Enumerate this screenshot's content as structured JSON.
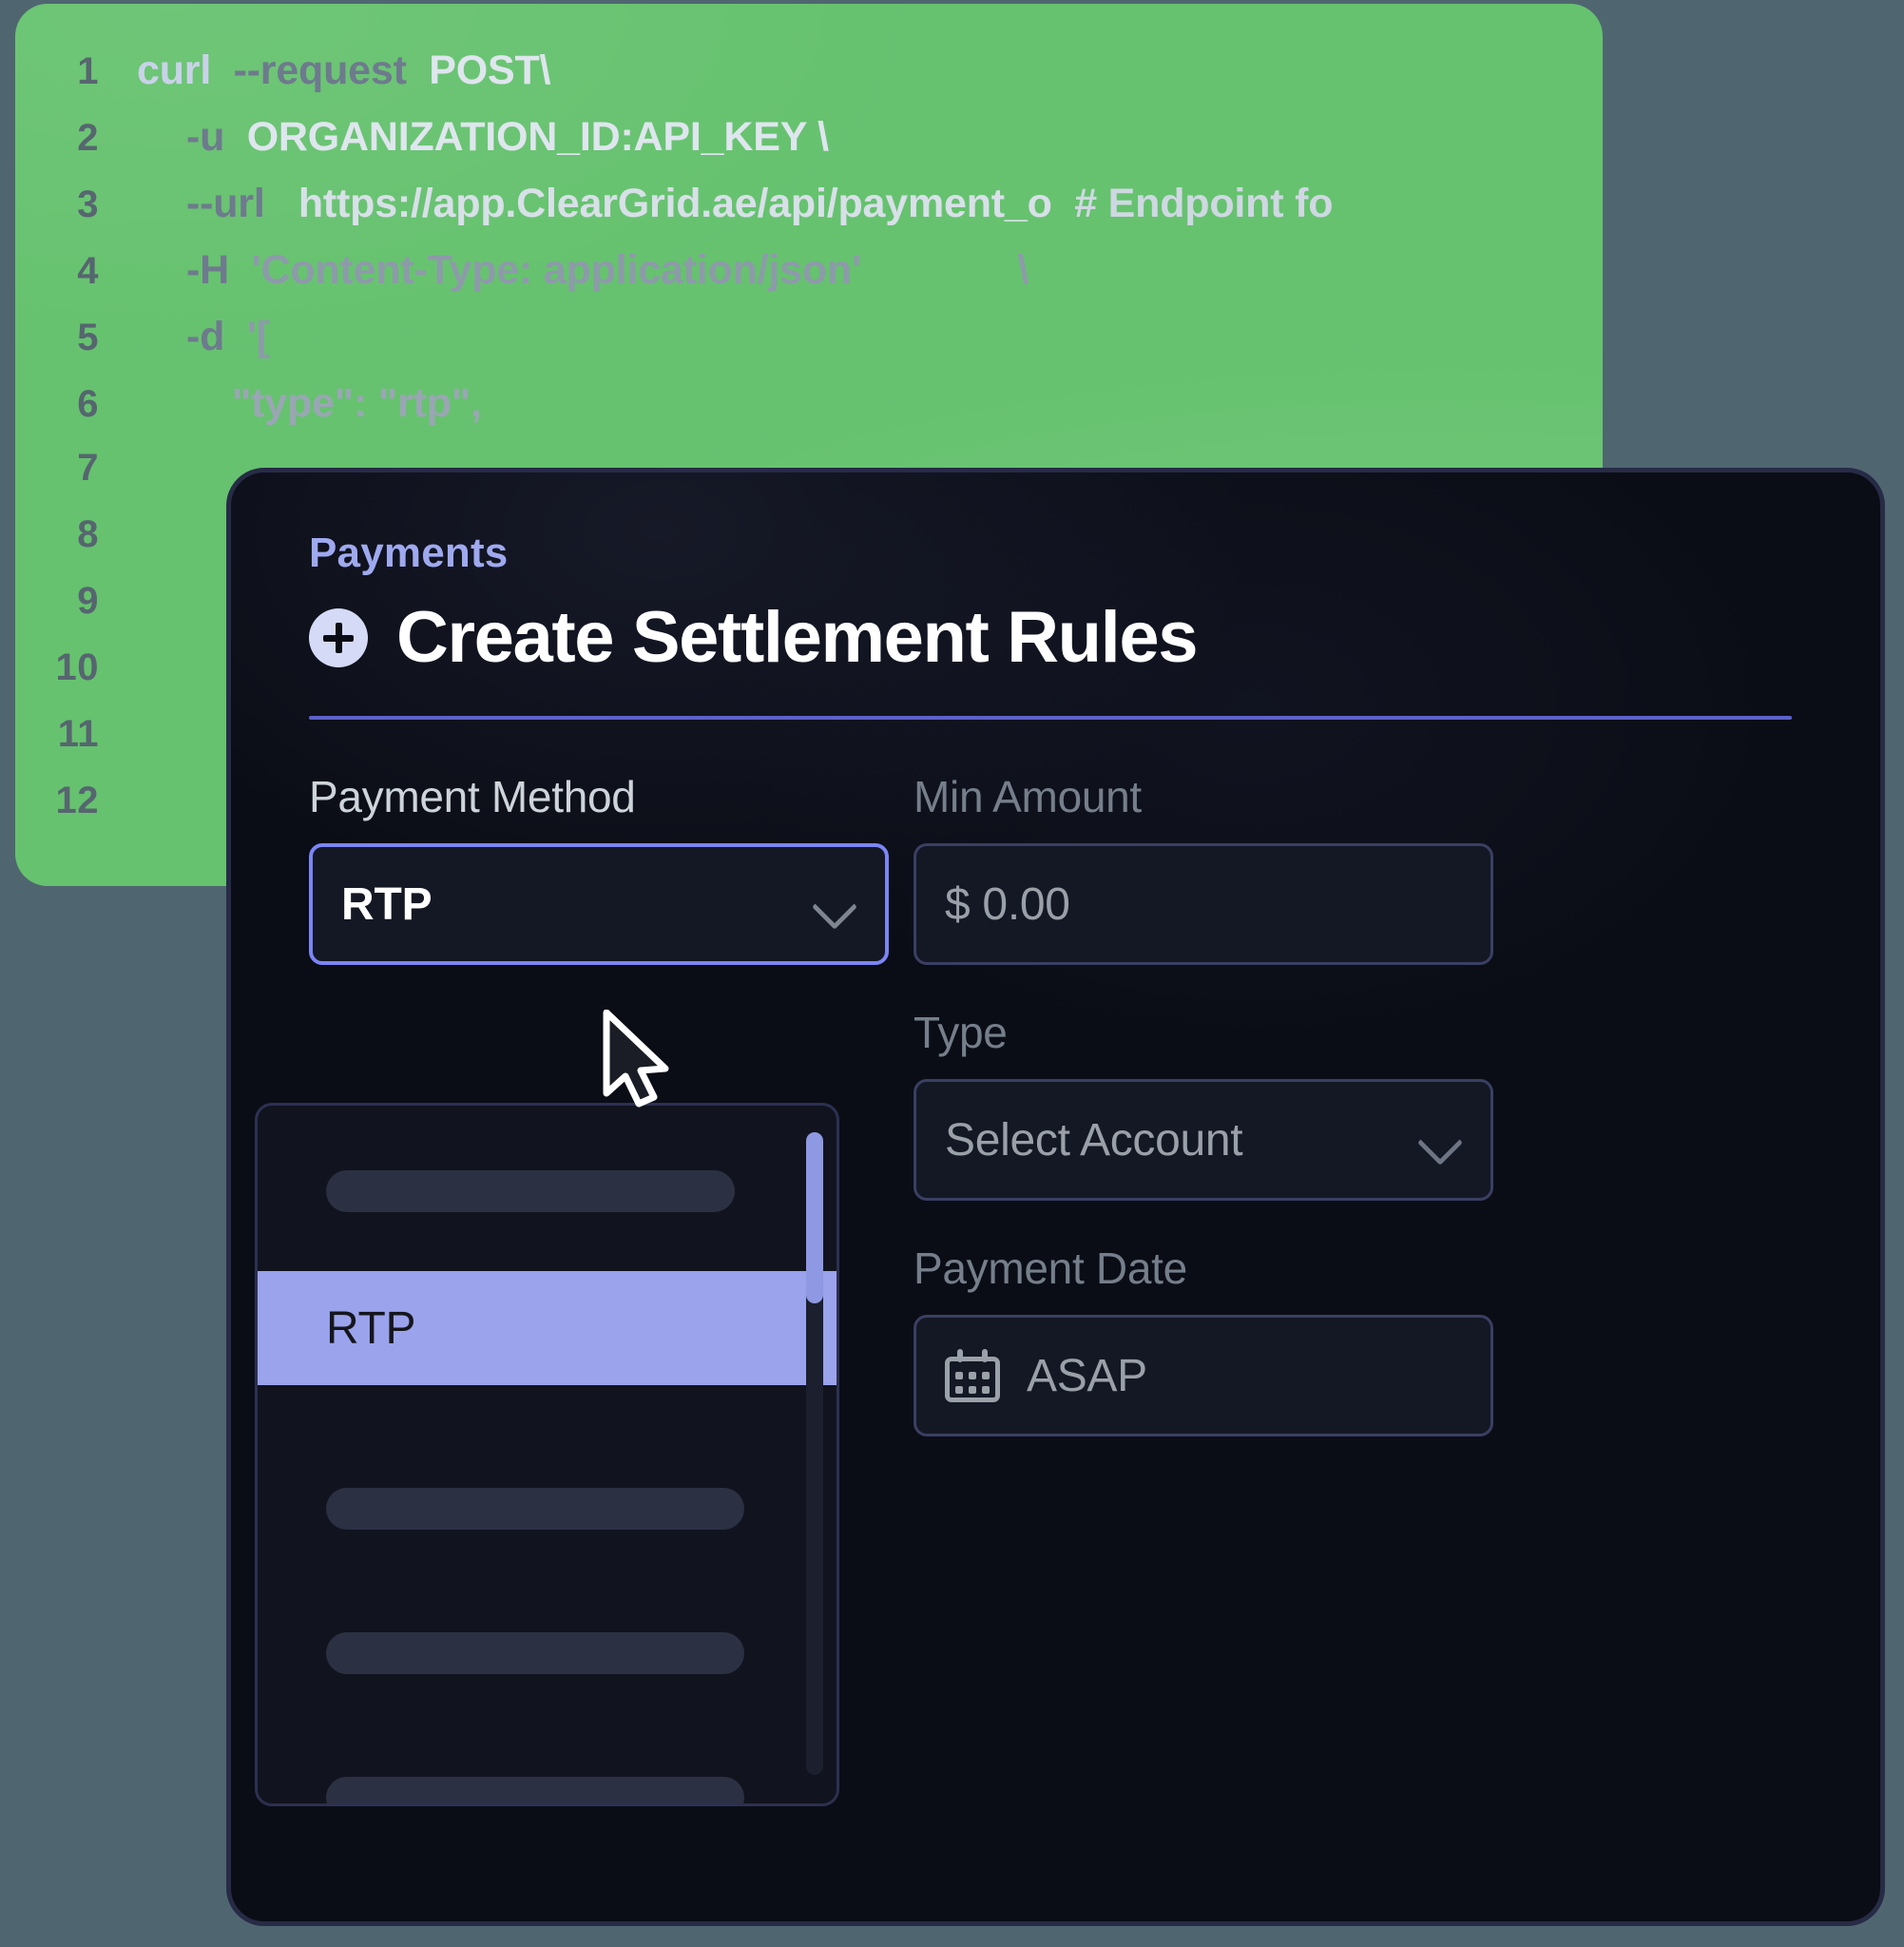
{
  "code_panel": {
    "language_hint": "bash",
    "lines": [
      {
        "number": "1",
        "text": "curl  --request  POST\\"
      },
      {
        "number": "2",
        "text": "-u  ORGANIZATION_ID:API_KEY \\"
      },
      {
        "number": "3",
        "text": "--url   https://app.ClearGrid.ae/api/payment_o  # Endpoint fo"
      },
      {
        "number": "4",
        "text": "-H  'Content-Type: application/json'              \\"
      },
      {
        "number": "5",
        "text": "-d  '["
      },
      {
        "number": "6",
        "text": "\"type\": \"rtp\","
      },
      {
        "number": "7",
        "text": ""
      },
      {
        "number": "8",
        "text": ""
      },
      {
        "number": "9",
        "text": ""
      },
      {
        "number": "10",
        "text": ""
      },
      {
        "number": "11",
        "text": ""
      },
      {
        "number": "12",
        "text": ""
      }
    ],
    "background_color": "#66c26f",
    "line_number_color": "#566170"
  },
  "modal": {
    "eyebrow": "Payments",
    "title": "Create Settlement Rules",
    "add_icon": "plus-circle-icon",
    "accent_color": "#5d62c9",
    "surface_color": "#0b0d16",
    "border_color": "#272b46",
    "fields": {
      "payment_method": {
        "label": "Payment Method",
        "value": "RTP",
        "state": "open",
        "chevron_icon": "chevron-down-icon"
      },
      "min_amount": {
        "label": "Min Amount",
        "placeholder": "$ 0.00",
        "value": ""
      },
      "type": {
        "label": "Type",
        "placeholder": "Select Account",
        "value": "",
        "chevron_icon": "chevron-down-icon"
      },
      "payment_date": {
        "label": "Payment Date",
        "placeholder": "ASAP",
        "value": "",
        "calendar_icon": "calendar-icon"
      }
    },
    "dropdown": {
      "highlighted_option": "RTP",
      "highlight_color": "#9aa3ec",
      "placeholder_rows": 4,
      "scrollbar": "vertical-scrollbar"
    }
  },
  "pointer": {
    "icon": "mouse-cursor-arrow"
  },
  "canvas": {
    "background_color": "#4f6670"
  }
}
